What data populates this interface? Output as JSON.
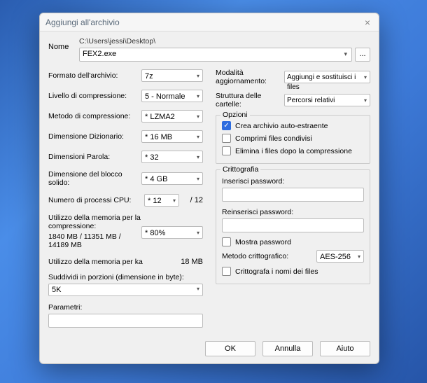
{
  "window": {
    "title": "Aggiungi all'archivio",
    "close": "×"
  },
  "name": {
    "label": "Nome",
    "path": "C:\\Users\\jessi\\Desktop\\",
    "value": "FEX2.exe",
    "browse": "..."
  },
  "left": {
    "format": {
      "label": "Formato dell'archivio:",
      "value": "7z"
    },
    "level": {
      "label": "Livello di compressione:",
      "value": "5 - Normale"
    },
    "method": {
      "label": "Metodo di compressione:",
      "value": "* LZMA2"
    },
    "dict": {
      "label": "Dimensione Dizionario:",
      "value": "* 16 MB"
    },
    "word": {
      "label": "Dimensioni Parola:",
      "value": "* 32"
    },
    "solid": {
      "label": "Dimensione del blocco solido:",
      "value": "* 4 GB"
    },
    "cpu": {
      "label": "Numero di processi CPU:",
      "value": "* 12",
      "suffix": "/ 12"
    },
    "mem_compress": {
      "label": "Utilizzo della memoria per la compressione:",
      "detail": "1840 MB / 11351 MB / 14189 MB",
      "value": "* 80%"
    },
    "mem_ka": {
      "label": "Utilizzo della memoria per ka",
      "value": "18 MB"
    },
    "split": {
      "label": "Suddividi in porzioni (dimensione in byte):",
      "value": "5K"
    },
    "params": {
      "label": "Parametri:",
      "value": ""
    }
  },
  "right": {
    "update": {
      "label": "Modalità aggiornamento:",
      "value": "Aggiungi e sostituisci i files"
    },
    "paths": {
      "label": "Struttura delle cartelle:",
      "value": "Percorsi relativi"
    },
    "options": {
      "title": "Opzioni",
      "sfx": "Crea archivio auto-estraente",
      "shared": "Comprimi files condivisi",
      "delete": "Elimina i files dopo la compressione"
    },
    "crypto": {
      "title": "Crittografia",
      "pw1": "Inserisci password:",
      "pw2": "Reinserisci password:",
      "show": "Mostra password",
      "method_label": "Metodo crittografico:",
      "method_value": "AES-256",
      "encrypt_names": "Crittografa i nomi dei files"
    }
  },
  "buttons": {
    "ok": "OK",
    "cancel": "Annulla",
    "help": "Aiuto"
  }
}
